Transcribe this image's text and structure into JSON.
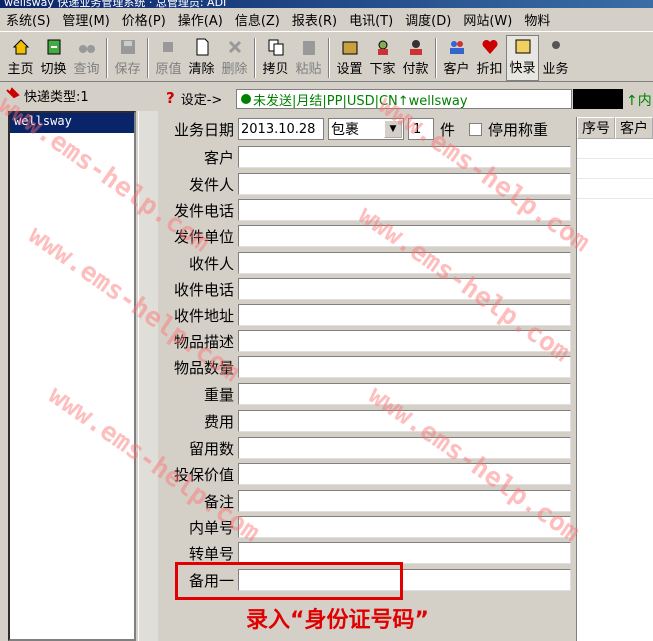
{
  "title_text": "wellsway  快递业务管理系统  ·  总管理员: ADI",
  "menu": [
    "系统(S)",
    "管理(M)",
    "价格(P)",
    "操作(A)",
    "信息(Z)",
    "报表(R)",
    "电讯(T)",
    "调度(D)",
    "网站(W)",
    "物料"
  ],
  "toolbar": [
    "主页",
    "切换",
    "查询",
    "保存",
    "原值",
    "清除",
    "删除",
    "拷贝",
    "粘贴",
    "设置",
    "下家",
    "付款",
    "客户",
    "折扣",
    "快录",
    "业务"
  ],
  "left_panel": {
    "header": "快递类型:1",
    "selected_item": "wellsway"
  },
  "setbar": {
    "label": "设定->",
    "status": "未发送|月结|PP|USD|CN↑wellsway"
  },
  "date_row": {
    "label": "业务日期",
    "date": "2013.10.28",
    "package_type": "包裹",
    "count": "1",
    "unit": "件",
    "checkbox_label": "停用称重"
  },
  "fields": [
    "客户",
    "发件人",
    "发件电话",
    "发件单位",
    "收件人",
    "收件电话",
    "收件地址",
    "物品描述",
    "物品数量",
    "重量",
    "费用",
    "留用数",
    "投保价值",
    "备注",
    "内单号",
    "转单号",
    "备用一"
  ],
  "right_panel": {
    "inner_label": "↑内",
    "columns": [
      "序号",
      "客户"
    ]
  },
  "annotation": "录入“身份证号码”",
  "watermark": "www.ems-help.com"
}
